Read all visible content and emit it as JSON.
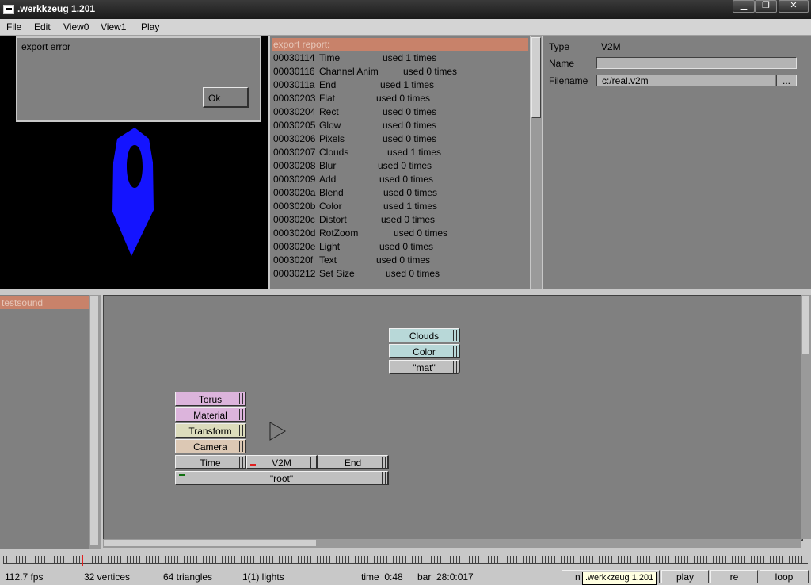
{
  "window": {
    "title": ".werkkzeug 1.201",
    "minimize": "▁",
    "maximize": "❐",
    "close": "✕"
  },
  "menu": [
    "File",
    "Edit",
    "View0",
    "View1",
    "Play"
  ],
  "dialog": {
    "message": "export error",
    "ok_label": "Ok"
  },
  "preview": {
    "shape_color": "#1414ff",
    "background": "#000000"
  },
  "report": {
    "header": "export report:",
    "rows": [
      {
        "id": "00030114",
        "name": "Time",
        "usage": "used 1 times"
      },
      {
        "id": "00030116",
        "name": "Channel Anim",
        "usage": "used 0 times"
      },
      {
        "id": "0003011a",
        "name": "End",
        "usage": "used 1 times"
      },
      {
        "id": "00030203",
        "name": "Flat",
        "usage": "used 0 times"
      },
      {
        "id": "00030204",
        "name": "Rect",
        "usage": "used 0 times"
      },
      {
        "id": "00030205",
        "name": "Glow",
        "usage": "used 0 times"
      },
      {
        "id": "00030206",
        "name": "Pixels",
        "usage": "used 0 times"
      },
      {
        "id": "00030207",
        "name": "Clouds",
        "usage": "used 1 times"
      },
      {
        "id": "00030208",
        "name": "Blur",
        "usage": "used 0 times"
      },
      {
        "id": "00030209",
        "name": "Add",
        "usage": "used 0 times"
      },
      {
        "id": "0003020a",
        "name": "Blend",
        "usage": "used 0 times"
      },
      {
        "id": "0003020b",
        "name": "Color",
        "usage": "used 1 times"
      },
      {
        "id": "0003020c",
        "name": "Distort",
        "usage": "used 0 times"
      },
      {
        "id": "0003020d",
        "name": "RotZoom",
        "usage": "used 0 times"
      },
      {
        "id": "0003020e",
        "name": "Light",
        "usage": "used 0 times"
      },
      {
        "id": "0003020f",
        "name": "Text",
        "usage": "used 0 times"
      },
      {
        "id": "00030212",
        "name": "Set Size",
        "usage": "used 0 times"
      }
    ]
  },
  "properties": {
    "type_label": "Type",
    "type_value": "V2M",
    "name_label": "Name",
    "name_value": "",
    "filename_label": "Filename",
    "filename_value": "c:/real.v2m",
    "browse_label": "..."
  },
  "pages": {
    "selected": "testsound"
  },
  "graph": {
    "ops": {
      "clouds": "Clouds",
      "color": "Color",
      "mat": "\"mat\"",
      "torus": "Torus",
      "material": "Material",
      "transform": "Transform",
      "camera": "Camera",
      "time": "Time",
      "v2m": "V2M",
      "end": "End",
      "root": "\"root\""
    },
    "colors": {
      "texture": "#b8d8d8",
      "mesh": "#dcb4dc",
      "scene": "#dcdcbc",
      "camera": "#dcc8b4",
      "gray": "#c0c0c0"
    }
  },
  "status": {
    "fps": "112.7 fps",
    "vertices": "32 vertices",
    "triangles": "64 triangles",
    "lights": "1(1) lights",
    "time": "time  0:48",
    "bar": "bar  28:0:017",
    "btn_n": "n",
    "btn_play": "play",
    "btn_re": "re",
    "btn_loop": "loop",
    "tooltip": ".werkkzeug 1.201"
  }
}
